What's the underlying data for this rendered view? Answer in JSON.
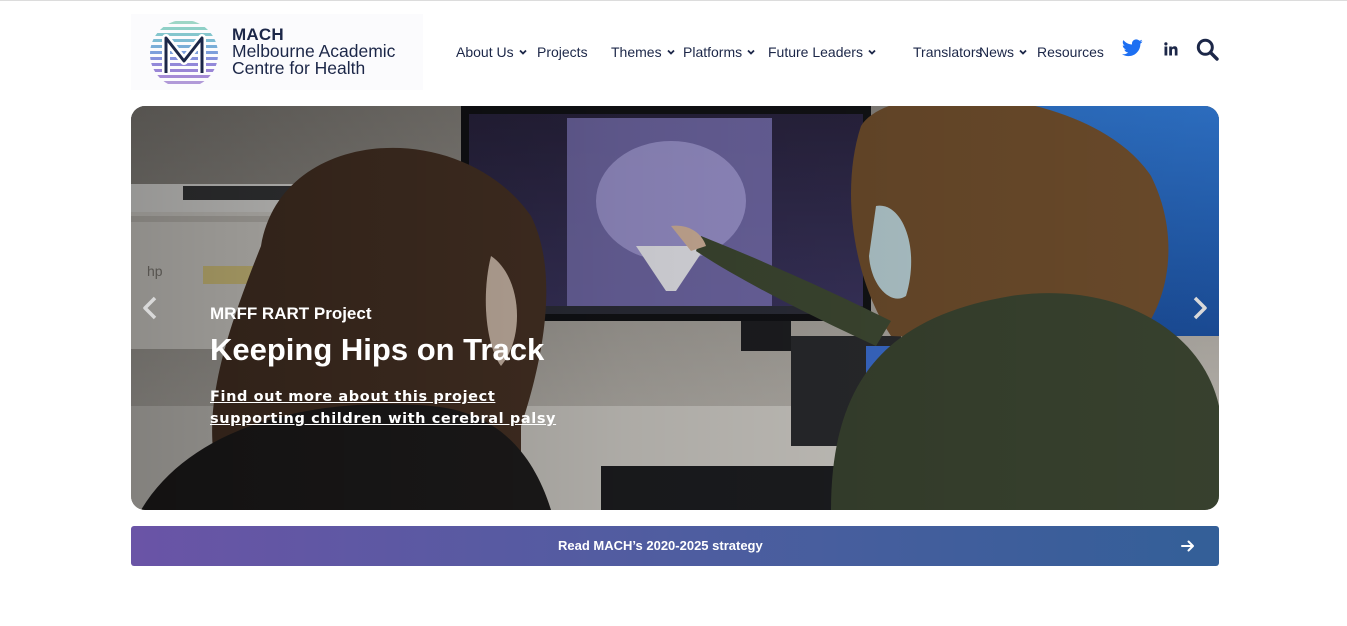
{
  "logo": {
    "abbr": "MACH",
    "line1": "Melbourne Academic",
    "line2": "Centre for Health",
    "icon": "mach-logo-icon"
  },
  "nav": {
    "items": [
      {
        "label": "About Us",
        "dropdown": true
      },
      {
        "label": "Projects",
        "dropdown": false
      },
      {
        "label": "Themes",
        "dropdown": true
      },
      {
        "label": "Platforms",
        "dropdown": true
      },
      {
        "label": "Future Leaders",
        "dropdown": true
      },
      {
        "label": "Translators",
        "dropdown": false
      },
      {
        "label": "News",
        "dropdown": true
      },
      {
        "label": "Resources",
        "dropdown": false
      }
    ],
    "social": {
      "twitter_icon": "twitter-icon",
      "linkedin_icon": "linkedin-icon",
      "search_icon": "search-icon"
    }
  },
  "hero": {
    "kicker": "MRFF RART Project",
    "title": "Keeping Hips on Track",
    "link_text": "Find out more about this project supporting children with cerebral palsy",
    "prev_icon": "chevron-left-icon",
    "next_icon": "chevron-right-icon"
  },
  "banner": {
    "label": "Read MACH’s 2020-2025 strategy",
    "icon": "arrow-right-icon"
  },
  "colors": {
    "navy": "#1c2748",
    "twitter": "#1d6ff2",
    "banner_start": "#6a54a6",
    "banner_end": "#335f98"
  }
}
